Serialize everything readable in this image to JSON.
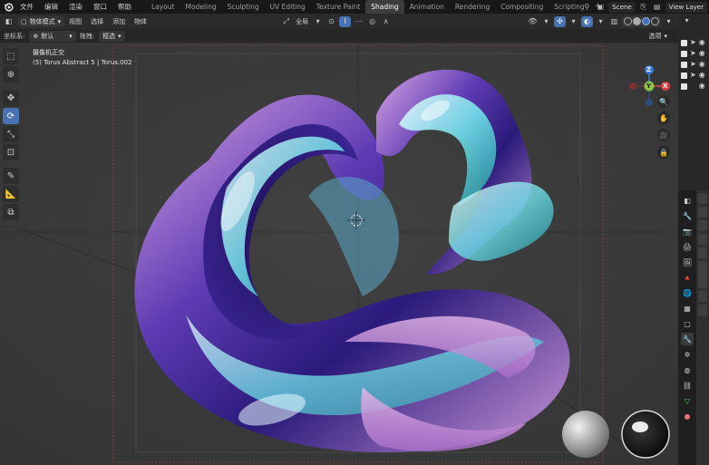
{
  "menubar": {
    "menus": [
      "文件",
      "编辑",
      "渲染",
      "窗口",
      "帮助"
    ],
    "tabs": [
      "Layout",
      "Modeling",
      "Sculpting",
      "UV Editing",
      "Texture Paint",
      "Shading",
      "Animation",
      "Rendering",
      "Compositing",
      "Scripting"
    ],
    "active_tab": "Shading",
    "add_tab": "+",
    "scene_label": "Scene",
    "view_layer_label": "View Layer"
  },
  "header1": {
    "mode": "物体模式",
    "menus": [
      "视图",
      "选择",
      "添加",
      "物体"
    ],
    "transform_orientation": "全局",
    "options_label": "选项"
  },
  "header2": {
    "coord_label": "坐标系:",
    "coord_value": "默认",
    "drag_label": "拖拽:",
    "drag_value": "框选"
  },
  "viewport": {
    "view_name": "摄像机正交",
    "object_info": "(5) Torus Abstract 5 | Torus.002"
  },
  "gizmo": {
    "x": "X",
    "y": "Y",
    "z": "Z"
  },
  "colors": {
    "accent": "#4772b3",
    "axis_x": "#e0403f",
    "axis_y": "#8bc34a",
    "axis_z": "#3b7bd6"
  }
}
